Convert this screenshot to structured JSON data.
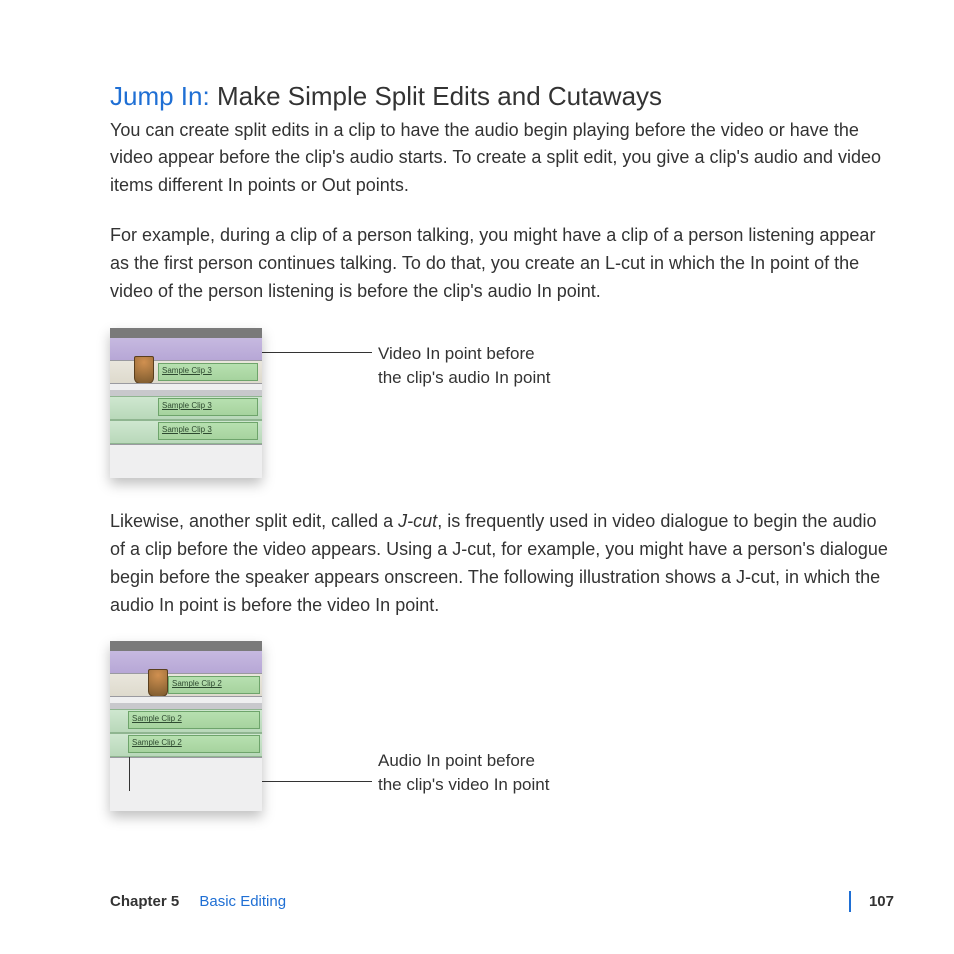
{
  "heading": {
    "jump_in": "Jump In:",
    "title": "Make Simple Split Edits and Cutaways"
  },
  "paragraphs": {
    "p1": "You can create split edits in a clip to have the audio begin playing before the video or have the video appear before the clip's audio starts. To create a split edit, you give a clip's audio and video items different In points or Out points.",
    "p2": "For example, during a clip of a person talking, you might have a clip of a person listening appear as the first person continues talking. To do that, you create an L-cut in which the In point of the video of the person listening is before the clip's audio In point.",
    "p3a": "Likewise, another split edit, called a ",
    "p3_em": "J-cut",
    "p3b": ", is frequently used in video dialogue to begin the audio of a clip before the video appears. Using a J-cut, for example, you might have a person's dialogue begin before the speaker appears onscreen. The following illustration shows a J-cut, in which the audio In point is before the video In point."
  },
  "figure1": {
    "callout_l1": "Video In point before",
    "callout_l2": "the clip's audio In point",
    "clip_label_v": "Sample Clip 3",
    "clip_label_a1": "Sample Clip 3",
    "clip_label_a2": "Sample Clip 3"
  },
  "figure2": {
    "callout_l1": "Audio In point before",
    "callout_l2": "the clip's video In point",
    "clip_label_v": "Sample Clip 2",
    "clip_label_a1": "Sample Clip 2",
    "clip_label_a2": "Sample Clip 2"
  },
  "footer": {
    "chapter": "Chapter 5",
    "title": "Basic Editing",
    "page": "107"
  }
}
